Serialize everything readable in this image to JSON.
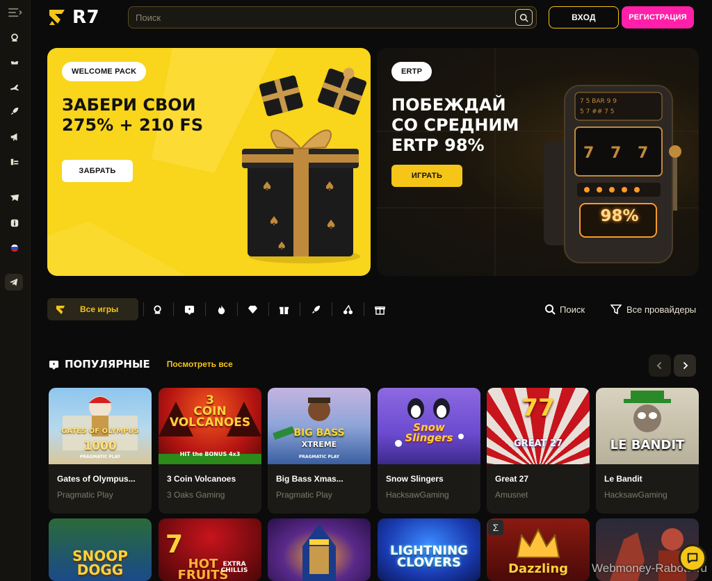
{
  "header": {
    "logo_text": "R7",
    "search_placeholder": "Поиск",
    "login_label": "ВХОД",
    "register_label": "РЕГИСТРАЦИЯ"
  },
  "banners": [
    {
      "badge": "WELCOME PACK",
      "title": "ЗАБЕРИ СВОИ\n275% + 210 FS",
      "cta": "ЗАБРАТЬ"
    },
    {
      "badge": "ERTP",
      "title": "ПОБЕЖДАЙ\nСО СРЕДНИМ\nERTP 98%",
      "cta": "ИГРАТЬ",
      "display_value": "98%"
    }
  ],
  "categories": {
    "all_label": "Все игры",
    "icons": [
      "live-casino-icon",
      "chip-icon",
      "fire-icon",
      "diamond-icon",
      "gift-box-icon",
      "rocket-icon",
      "cherry-icon",
      "present-icon"
    ],
    "search_label": "Поиск",
    "providers_label": "Все провайдеры"
  },
  "popular": {
    "title": "ПОПУЛЯРНЫЕ",
    "view_all": "Посмотреть все",
    "games": [
      {
        "name": "Gates of Olympus...",
        "provider": "Pragmatic Play",
        "art": "GATES OF OLYMPUS",
        "art_sub": "1000",
        "tag": "PRAGMATIC PLAY",
        "color": "#7fb8e6"
      },
      {
        "name": "3 Coin Volcanoes",
        "provider": "3 Oaks Gaming",
        "art": "3\nCOIN\nVOLCANOES",
        "art_sub": "HIT the BONUS 4x3",
        "color": "#c8211a"
      },
      {
        "name": "Big Bass Xmas...",
        "provider": "Pragmatic Play",
        "art": "BIG BASS",
        "art_sub": "XTREME",
        "tag": "PRAGMATIC PLAY",
        "color": "#5a7ab5"
      },
      {
        "name": "Snow Slingers",
        "provider": "HacksawGaming",
        "art": "Snow\nSlingers",
        "art_sub": "",
        "color": "#7b5bd6"
      },
      {
        "name": "Great 27",
        "provider": "Amusnet",
        "art": "77",
        "art_sub": "GREAT 27",
        "color": "#b8141c"
      },
      {
        "name": "Le Bandit",
        "provider": "HacksawGaming",
        "art": "LE BANDIT",
        "art_sub": "",
        "color": "#c7c1ae"
      }
    ]
  },
  "row2": [
    {
      "art": "SNOOP\nDOGG",
      "color": "#2f8a3a"
    },
    {
      "art": "HOT\nFRUITS",
      "art_extra": "EXTRA\nCHILLIS",
      "color": "#8a0f12"
    },
    {
      "art": "",
      "color": "#3a1f5e"
    },
    {
      "art": "LIGHTNING\nCLOVERS",
      "color": "#1a56c4"
    },
    {
      "art": "Dazzling",
      "color": "#6a0f10"
    },
    {
      "art": "",
      "color": "#1b1a2a"
    }
  ],
  "watermark": "Webmoney-Rabota.ru"
}
